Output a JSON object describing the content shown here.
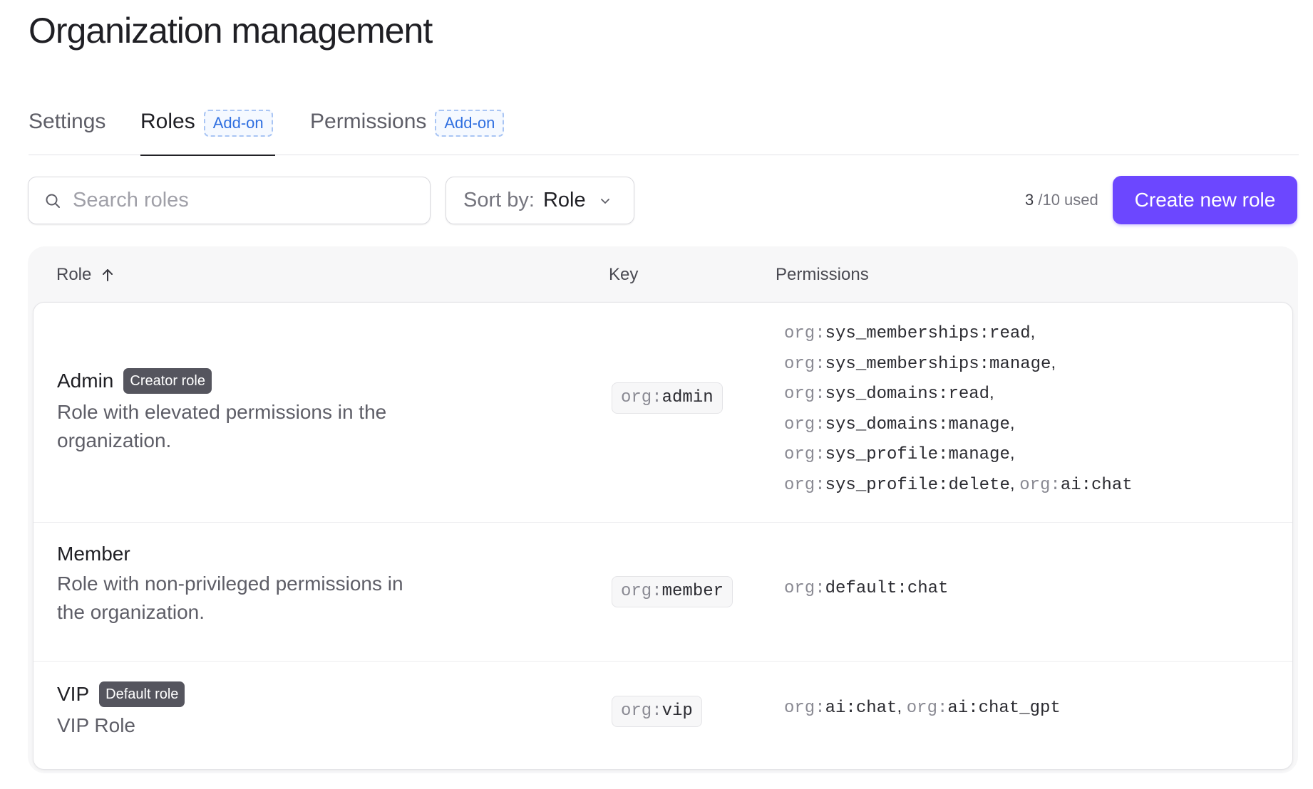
{
  "page": {
    "title": "Organization management"
  },
  "tabs": [
    {
      "label": "Settings",
      "badge": ""
    },
    {
      "label": "Roles",
      "badge": "Add-on"
    },
    {
      "label": "Permissions",
      "badge": "Add-on"
    }
  ],
  "toolbar": {
    "search_placeholder": "Search roles",
    "search_value": "",
    "sort_prefix": "Sort by:",
    "sort_value": "Role",
    "usage_count": "3",
    "usage_suffix": " /10 used",
    "create_label": "Create new role"
  },
  "table": {
    "headers": {
      "role": "Role",
      "key": "Key",
      "permissions": "Permissions"
    },
    "rows": [
      {
        "name": "Admin",
        "badge": "Creator role",
        "description": "Role with elevated permissions in the organization.",
        "key_prefix": "org:",
        "key_name": "admin",
        "permissions": [
          [
            "org:",
            "sys_memberships:read",
            ","
          ],
          [
            "org:",
            "sys_memberships:manage",
            ","
          ],
          [
            "org:",
            "sys_domains:read",
            ","
          ],
          [
            "org:",
            "sys_domains:manage",
            ","
          ],
          [
            "org:",
            "sys_profile:manage",
            ","
          ],
          [
            "org:",
            "sys_profile:delete",
            ", ",
            "org:",
            "ai:chat"
          ]
        ]
      },
      {
        "name": "Member",
        "badge": "",
        "description": "Role with non-privileged permissions in the organization.",
        "key_prefix": "org:",
        "key_name": "member",
        "permissions": [
          [
            "org:",
            "default:chat"
          ]
        ]
      },
      {
        "name": "VIP",
        "badge": "Default role",
        "description": "VIP Role",
        "key_prefix": "org:",
        "key_name": "vip",
        "permissions": [
          [
            "org:",
            "ai:chat",
            ", ",
            "org:",
            "ai:chat_gpt"
          ]
        ]
      }
    ]
  },
  "colors": {
    "accent": "#6c47ff",
    "badge_dark": "#55555e",
    "addon_blue": "#2f6fe0"
  },
  "icons": {
    "search": "search-icon",
    "chevron": "chevron-down-icon",
    "sort_arrow": "arrow-up-icon"
  }
}
